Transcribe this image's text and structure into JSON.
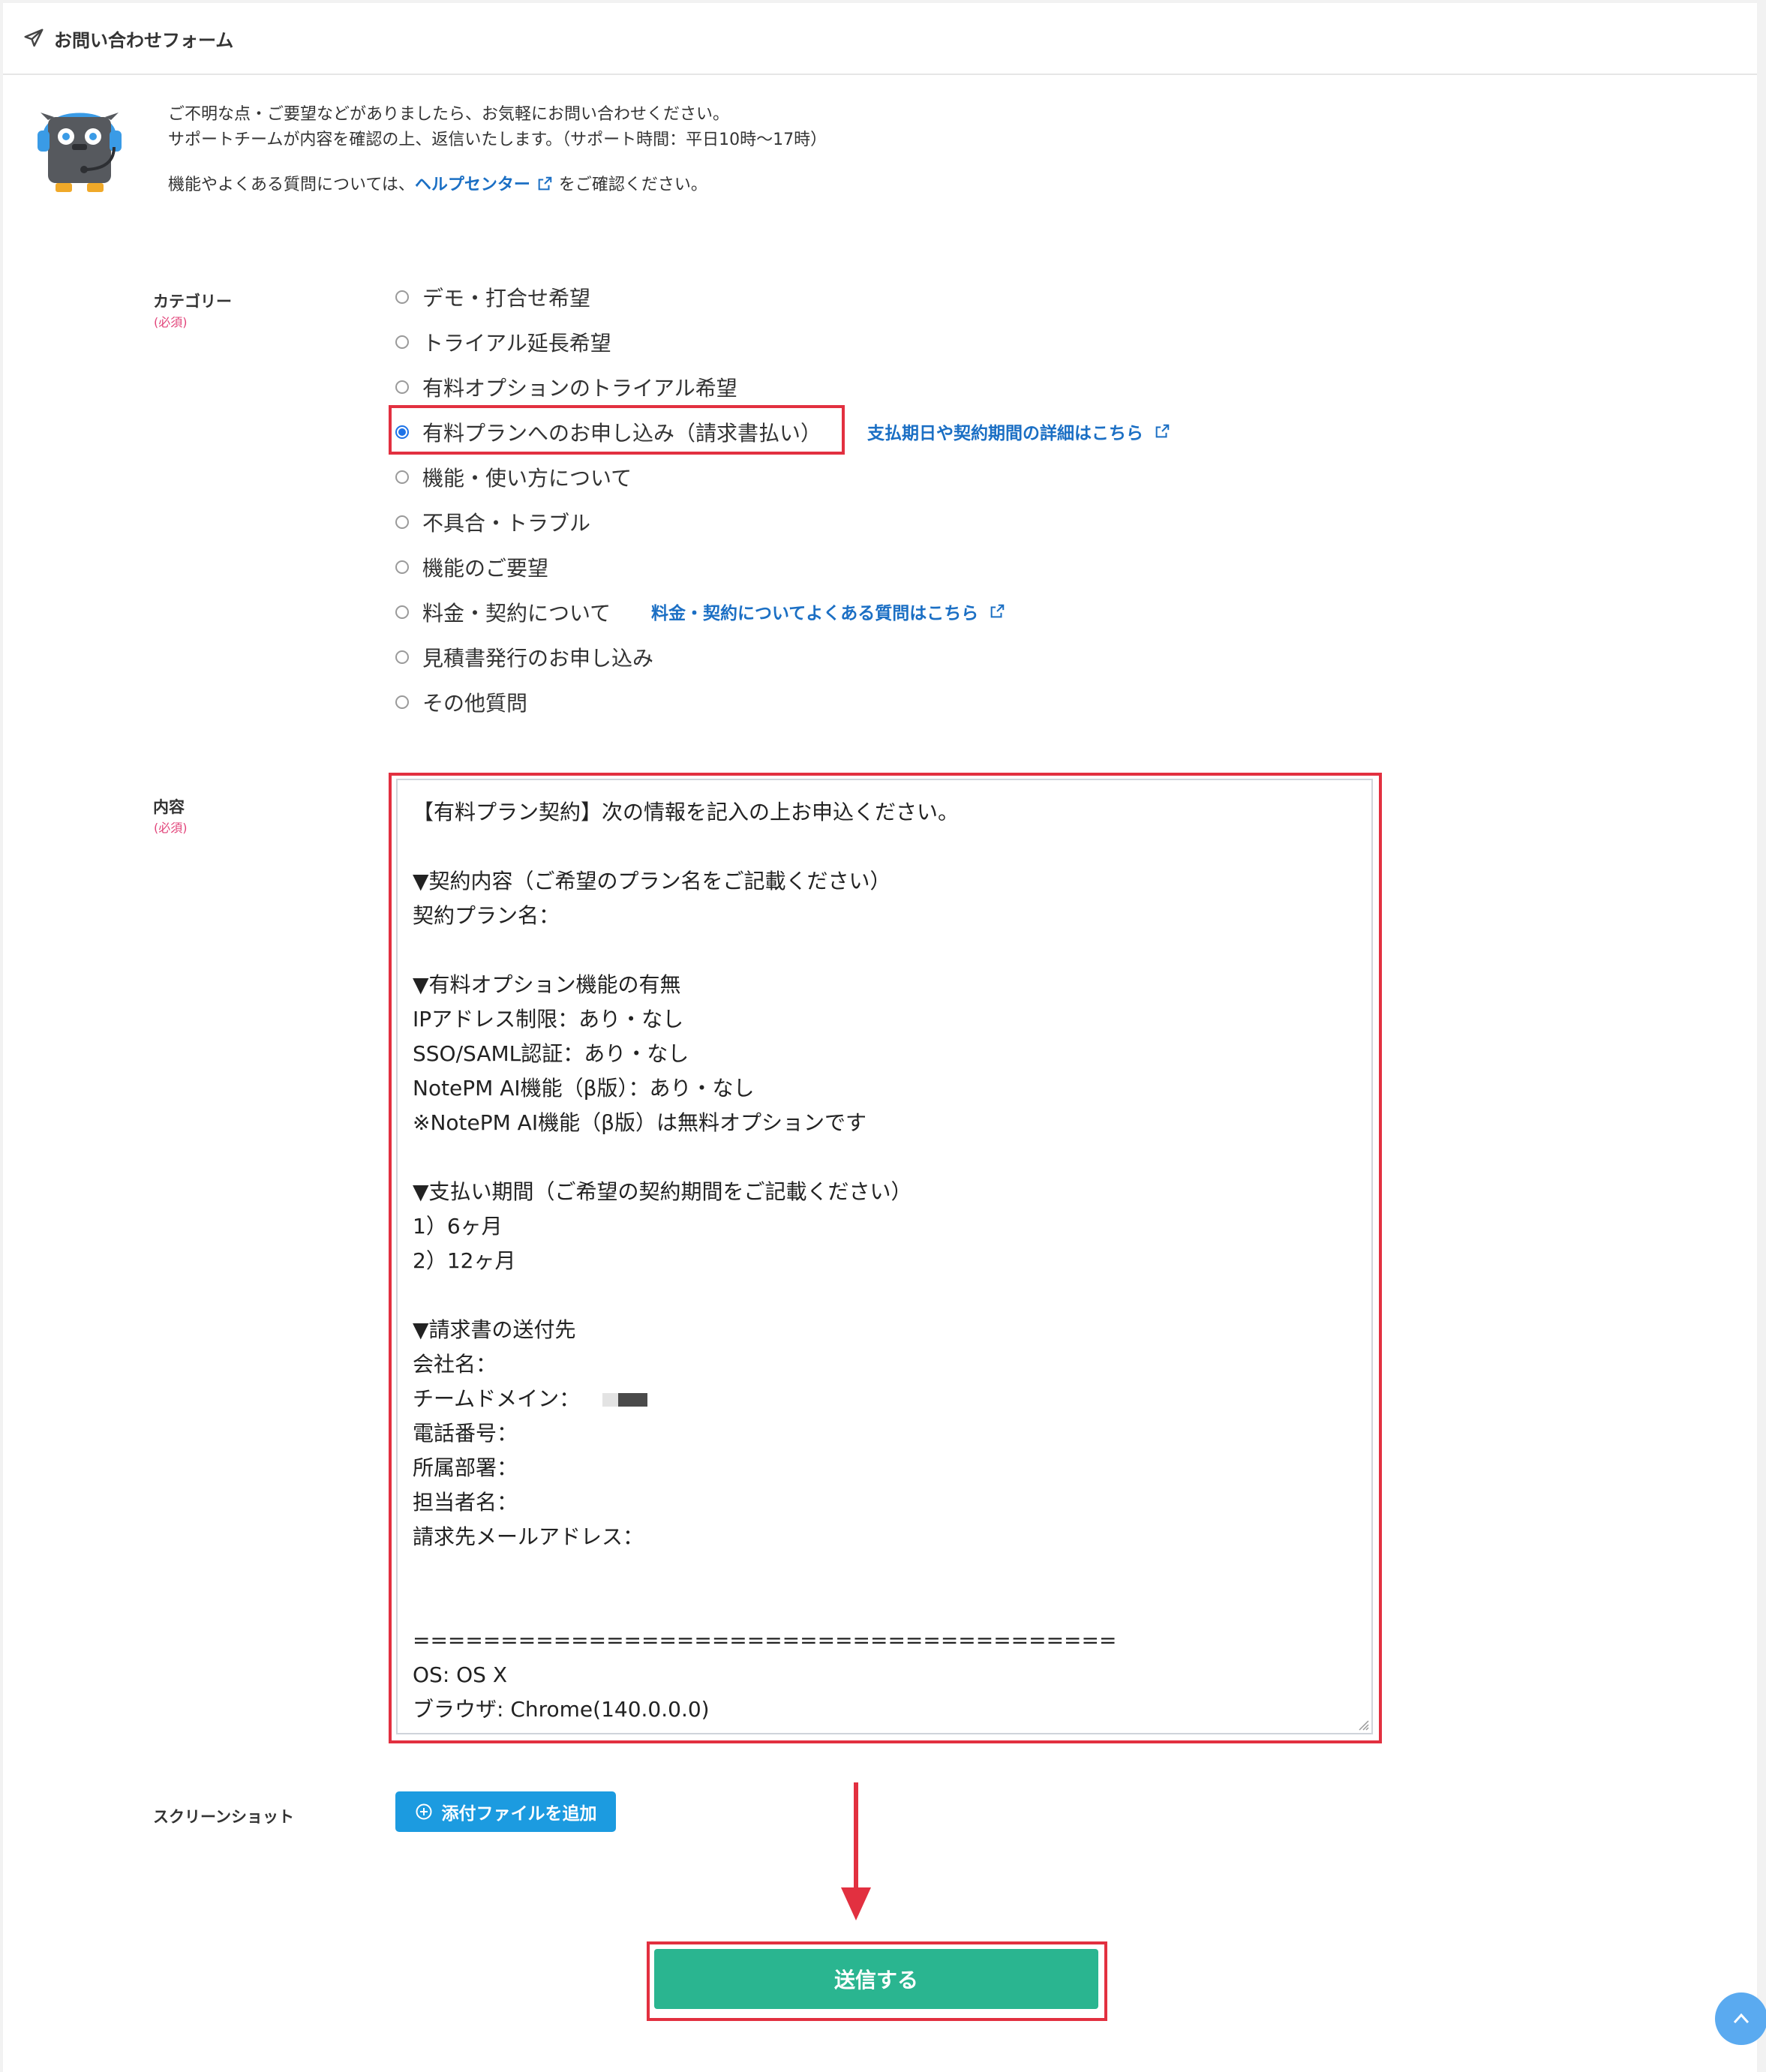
{
  "header": {
    "icon": "paper-plane-icon",
    "title": "お問い合わせフォーム"
  },
  "intro": {
    "line1": "ご不明な点・ご要望などがありましたら、お気軽にお問い合わせください。",
    "line2": "サポートチームが内容を確認の上、返信いたします。（サポート時間：平日10時〜17時）",
    "line3_prefix": "機能やよくある質問については、",
    "help_center_link": "ヘルプセンター",
    "line3_suffix": "をご確認ください。"
  },
  "category": {
    "label": "カテゴリー",
    "required": "(必須)",
    "options": [
      {
        "label": "デモ・打合せ希望",
        "checked": false
      },
      {
        "label": "トライアル延長希望",
        "checked": false
      },
      {
        "label": "有料オプションのトライアル希望",
        "checked": false
      },
      {
        "label": "有料プランへのお申し込み（請求書払い）",
        "checked": true
      },
      {
        "label": "機能・使い方について",
        "checked": false
      },
      {
        "label": "不具合・トラブル",
        "checked": false
      },
      {
        "label": "機能のご要望",
        "checked": false
      },
      {
        "label": "料金・契約について",
        "checked": false
      },
      {
        "label": "見積書発行のお申し込み",
        "checked": false
      },
      {
        "label": "その他質問",
        "checked": false
      }
    ],
    "payment_details_link": "支払期日や契約期間の詳細はこちら",
    "pricing_faq_link": "料金・契約についてよくある質問はこちら"
  },
  "content": {
    "label": "内容",
    "required": "(必須)",
    "lines": [
      "【有料プラン契約】次の情報を記入の上お申込ください。",
      "",
      "▼契約内容（ご希望のプラン名をご記載ください）",
      "契約プラン名：",
      "",
      "▼有料オプション機能の有無",
      "IPアドレス制限：あり・なし",
      "SSO/SAML認証：あり・なし",
      "NotePM AI機能（β版）：あり・なし",
      "※NotePM AI機能（β版）は無料オプションです",
      "",
      "▼支払い期間（ご希望の契約期間をご記載ください）",
      "1）6ヶ月",
      "2）12ヶ月",
      "",
      "▼請求書の送付先",
      "会社名：",
      "チームドメイン：",
      "電話番号：",
      "所属部署：",
      "担当者名：",
      "請求先メールアドレス：",
      "",
      "",
      "========================================",
      "OS: OS X",
      "ブラウザ: Chrome(140.0.0.0)"
    ]
  },
  "screenshot": {
    "label": "スクリーンショット",
    "attach_button": "添付ファイルを追加"
  },
  "submit": {
    "label": "送信する"
  },
  "colors": {
    "link": "#1b6fc4",
    "highlight": "#e23040",
    "submit": "#2ab590",
    "attach": "#1c9be0",
    "required": "#e2447a"
  }
}
